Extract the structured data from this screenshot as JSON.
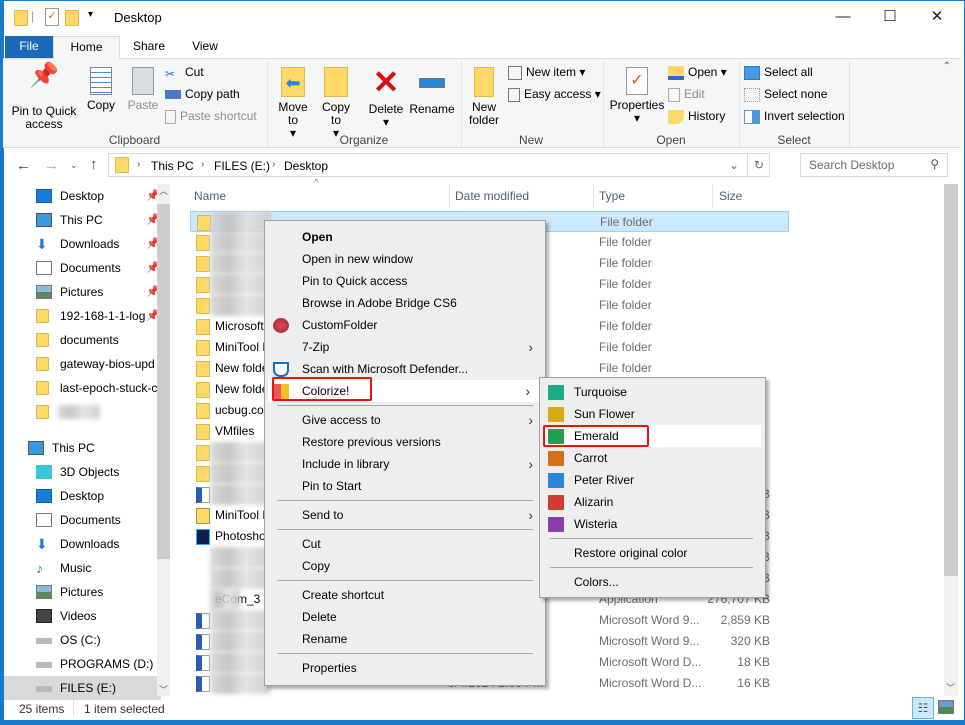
{
  "window": {
    "title": "Desktop",
    "minimize": "—",
    "maximize": "☐",
    "close": "✕"
  },
  "tabs": {
    "file": "File",
    "home": "Home",
    "share": "Share",
    "view": "View"
  },
  "ribbon": {
    "clipboard": {
      "label": "Clipboard",
      "pin": "Pin to Quick access",
      "copy": "Copy",
      "paste": "Paste",
      "cut": "Cut",
      "copy_path": "Copy path",
      "paste_shortcut": "Paste shortcut"
    },
    "organize": {
      "label": "Organize",
      "move_to": "Move to",
      "copy_to": "Copy to",
      "delete": "Delete",
      "rename": "Rename"
    },
    "new": {
      "label": "New",
      "new_folder": "New folder",
      "new_item": "New item",
      "easy_access": "Easy access"
    },
    "open": {
      "label": "Open",
      "properties": "Properties",
      "open": "Open",
      "edit": "Edit",
      "history": "History"
    },
    "select": {
      "label": "Select",
      "select_all": "Select all",
      "select_none": "Select none",
      "invert": "Invert selection"
    }
  },
  "address": {
    "crumbs": [
      "This PC",
      "FILES (E:)",
      "Desktop"
    ],
    "search_placeholder": "Search Desktop"
  },
  "nav": {
    "quick": [
      {
        "label": "Desktop",
        "icon": "desktop-icon",
        "pinned": true
      },
      {
        "label": "This PC",
        "icon": "pc-icon",
        "pinned": true
      },
      {
        "label": "Downloads",
        "icon": "download-icon",
        "pinned": true
      },
      {
        "label": "Documents",
        "icon": "document-icon",
        "pinned": true
      },
      {
        "label": "Pictures",
        "icon": "pictures-icon",
        "pinned": true
      },
      {
        "label": "192-168-1-1-log",
        "icon": "folder-icon",
        "pinned": true
      },
      {
        "label": "documents",
        "icon": "folder-icon"
      },
      {
        "label": "gateway-bios-upd",
        "icon": "folder-icon"
      },
      {
        "label": "last-epoch-stuck-c",
        "icon": "folder-icon"
      },
      {
        "label": "",
        "icon": "folder-icon"
      }
    ],
    "this_pc": "This PC",
    "pc": [
      {
        "label": "3D Objects",
        "icon": "3d-objects-icon"
      },
      {
        "label": "Desktop",
        "icon": "desktop-icon"
      },
      {
        "label": "Documents",
        "icon": "document-icon"
      },
      {
        "label": "Downloads",
        "icon": "download-icon"
      },
      {
        "label": "Music",
        "icon": "music-icon"
      },
      {
        "label": "Pictures",
        "icon": "pictures-icon"
      },
      {
        "label": "Videos",
        "icon": "videos-icon"
      },
      {
        "label": "OS (C:)",
        "icon": "drive-icon"
      },
      {
        "label": "PROGRAMS (D:)",
        "icon": "drive-icon"
      },
      {
        "label": "FILES (E:)",
        "icon": "drive-icon",
        "selected": true
      }
    ]
  },
  "columns": {
    "name": "Name",
    "date": "Date modified",
    "type": "Type",
    "size": "Size"
  },
  "rows": [
    {
      "name": "",
      "date": "",
      "type": "File folder",
      "size": "",
      "icon": "folder",
      "selected": true
    },
    {
      "name": "",
      "date": "",
      "type": "File folder",
      "size": "",
      "icon": "folder"
    },
    {
      "name": "",
      "date": "AM",
      "type": "File folder",
      "size": "",
      "icon": "folder"
    },
    {
      "name": "",
      "date": "M",
      "type": "File folder",
      "size": "",
      "icon": "folder"
    },
    {
      "name": "",
      "date": "M",
      "type": "File folder",
      "size": "",
      "icon": "folder"
    },
    {
      "name": "Microsoft",
      "date": "",
      "type": "File folder",
      "size": "",
      "icon": "folder"
    },
    {
      "name": "MiniTool P",
      "date": "M",
      "type": "File folder",
      "size": "",
      "icon": "folder"
    },
    {
      "name": "New folde",
      "date": "",
      "type": "File folder",
      "size": "",
      "icon": "folder"
    },
    {
      "name": "New folde",
      "date": "",
      "type": "",
      "size": "",
      "icon": "folder"
    },
    {
      "name": "ucbug.com",
      "date": "",
      "type": "",
      "size": "",
      "icon": "folder"
    },
    {
      "name": "VMfiles",
      "date": "",
      "type": "",
      "size": "",
      "icon": "folder"
    },
    {
      "name": "",
      "date": "",
      "type": "",
      "size": "",
      "icon": "folder"
    },
    {
      "name": "",
      "date": "",
      "type": "",
      "size": "",
      "icon": "folder"
    },
    {
      "name": "",
      "date": "",
      "type": "",
      "size": "2 KB",
      "icon": "word"
    },
    {
      "name": "MiniTool P",
      "date": "",
      "type": "",
      "size": "0 KB",
      "icon": "zip"
    },
    {
      "name": "Photosho",
      "date": "",
      "type": "",
      "size": "3 KB",
      "icon": "ps"
    },
    {
      "name": "",
      "date": "",
      "type": "",
      "size": "5 KB",
      "icon": "blank"
    },
    {
      "name": "",
      "date": "",
      "type": "",
      "size": "1 KB",
      "icon": "blank"
    },
    {
      "name": "eCom_3",
      "date": "M",
      "type": "Application",
      "size": "276,707 KB",
      "icon": "blank"
    },
    {
      "name": "",
      "date": "",
      "type": "Microsoft Word 9...",
      "size": "2,859 KB",
      "icon": "word"
    },
    {
      "name": "",
      "date": "",
      "type": "Microsoft Word 9...",
      "size": "320 KB",
      "icon": "word"
    },
    {
      "name": "",
      "date": "M",
      "type": "Microsoft Word D...",
      "size": "18 KB",
      "icon": "word"
    },
    {
      "name": "",
      "date": "5/4/2024 2:00 PM",
      "type": "Microsoft Word D...",
      "size": "16 KB",
      "icon": "word"
    }
  ],
  "context_menu": [
    {
      "label": "Open",
      "bold": true
    },
    {
      "label": "Open in new window"
    },
    {
      "label": "Pin to Quick access"
    },
    {
      "label": "Browse in Adobe Bridge CS6"
    },
    {
      "label": "CustomFolder",
      "icon": "customfolder-icon"
    },
    {
      "label": "7-Zip",
      "submenu": true
    },
    {
      "label": "Scan with Microsoft Defender...",
      "icon": "defender-icon"
    },
    {
      "label": "Colorize!",
      "icon": "colorize-icon",
      "submenu": true,
      "highlighted": true
    },
    {
      "sep": true
    },
    {
      "label": "Give access to",
      "submenu": true
    },
    {
      "label": "Restore previous versions"
    },
    {
      "label": "Include in library",
      "submenu": true
    },
    {
      "label": "Pin to Start"
    },
    {
      "sep": true
    },
    {
      "label": "Send to",
      "submenu": true
    },
    {
      "sep": true
    },
    {
      "label": "Cut"
    },
    {
      "label": "Copy"
    },
    {
      "sep": true
    },
    {
      "label": "Create shortcut"
    },
    {
      "label": "Delete"
    },
    {
      "label": "Rename"
    },
    {
      "sep": true
    },
    {
      "label": "Properties"
    }
  ],
  "colorize_menu": [
    {
      "label": "Turquoise",
      "color": "#1aaa8a"
    },
    {
      "label": "Sun Flower",
      "color": "#d8ac10"
    },
    {
      "label": "Emerald",
      "color": "#22a050",
      "highlighted": true
    },
    {
      "label": "Carrot",
      "color": "#d4701a"
    },
    {
      "label": "Peter River",
      "color": "#2a84d8"
    },
    {
      "label": "Alizarin",
      "color": "#d03a30"
    },
    {
      "label": "Wisteria",
      "color": "#8a3ea8"
    },
    {
      "sep": true
    },
    {
      "label": "Restore original color"
    },
    {
      "sep": true
    },
    {
      "label": "Colors..."
    }
  ],
  "status": {
    "count": "25 items",
    "selected": "1 item selected"
  },
  "colors": {
    "accent": "#1979ca",
    "file_tab": "#1a68b8",
    "selection": "#cce8ff",
    "highlight_box": "#e11111"
  }
}
